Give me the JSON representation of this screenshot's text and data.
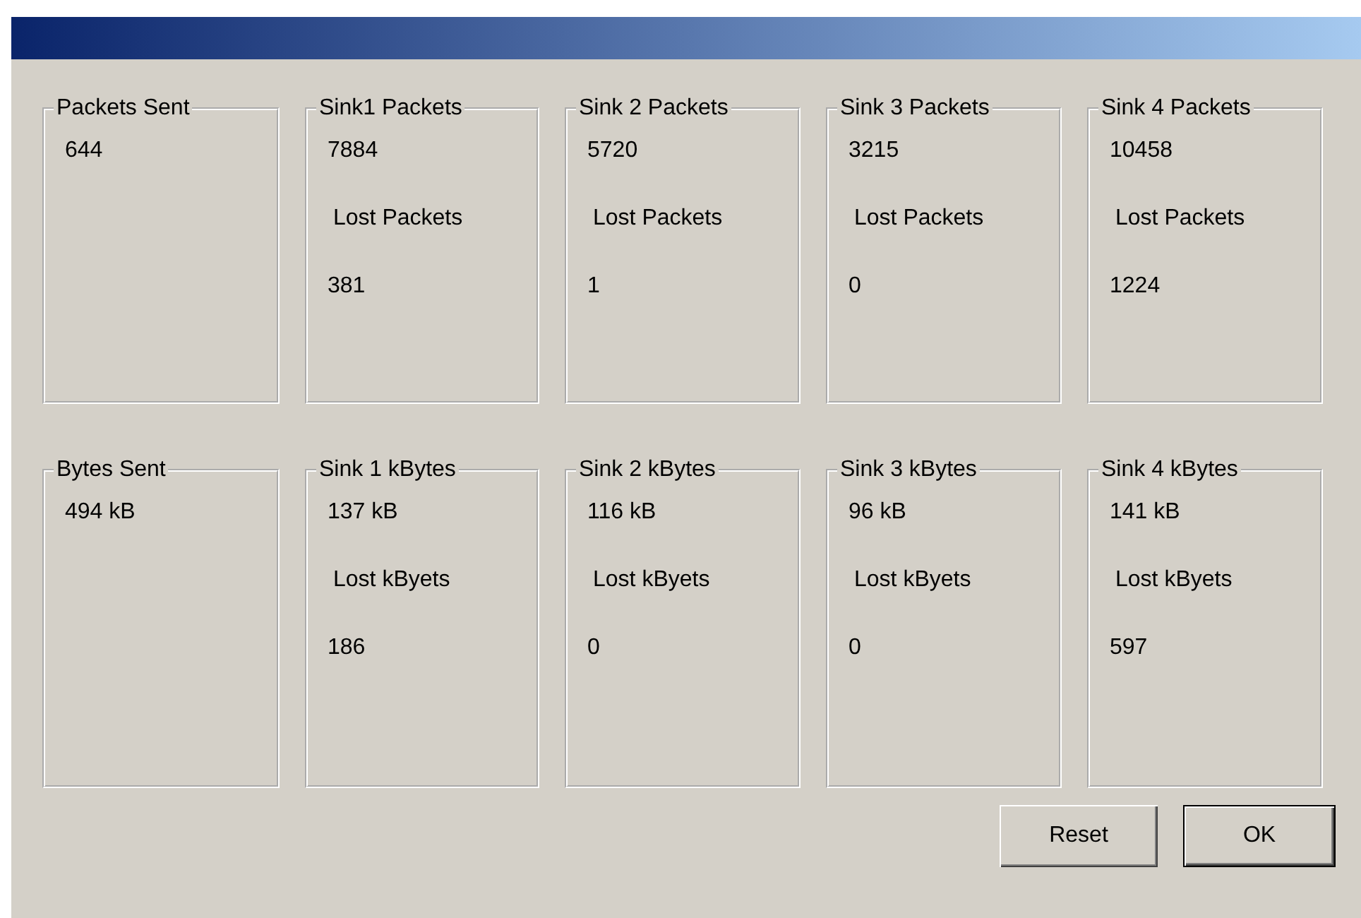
{
  "groups": [
    {
      "title": "Packets Sent",
      "lines": [
        {
          "kind": "value",
          "text": "644"
        }
      ]
    },
    {
      "title": "Sink1 Packets",
      "lines": [
        {
          "kind": "value",
          "text": "7884"
        },
        {
          "kind": "label",
          "text": "Lost Packets"
        },
        {
          "kind": "value",
          "text": "381"
        }
      ]
    },
    {
      "title": "Sink 2 Packets",
      "lines": [
        {
          "kind": "value",
          "text": "5720"
        },
        {
          "kind": "label",
          "text": "Lost Packets"
        },
        {
          "kind": "value",
          "text": "1"
        }
      ]
    },
    {
      "title": "Sink 3 Packets",
      "lines": [
        {
          "kind": "value",
          "text": "3215"
        },
        {
          "kind": "label",
          "text": "Lost Packets"
        },
        {
          "kind": "value",
          "text": "0"
        }
      ]
    },
    {
      "title": "Sink 4 Packets",
      "lines": [
        {
          "kind": "value",
          "text": "10458"
        },
        {
          "kind": "label",
          "text": "Lost Packets"
        },
        {
          "kind": "value",
          "text": "1224"
        }
      ]
    },
    {
      "title": "Bytes Sent",
      "lines": [
        {
          "kind": "value",
          "text": "494 kB"
        }
      ]
    },
    {
      "title": "Sink 1 kBytes",
      "lines": [
        {
          "kind": "value",
          "text": "137 kB"
        },
        {
          "kind": "label",
          "text": "Lost kByets"
        },
        {
          "kind": "value",
          "text": "186"
        }
      ]
    },
    {
      "title": "Sink 2 kBytes",
      "lines": [
        {
          "kind": "value",
          "text": "116 kB"
        },
        {
          "kind": "label",
          "text": "Lost kByets"
        },
        {
          "kind": "value",
          "text": "0"
        }
      ]
    },
    {
      "title": "Sink 3 kBytes",
      "lines": [
        {
          "kind": "value",
          "text": "96 kB"
        },
        {
          "kind": "label",
          "text": "Lost kByets"
        },
        {
          "kind": "value",
          "text": "0"
        }
      ]
    },
    {
      "title": "Sink 4 kBytes",
      "lines": [
        {
          "kind": "value",
          "text": "141 kB"
        },
        {
          "kind": "label",
          "text": "Lost kByets"
        },
        {
          "kind": "value",
          "text": "597"
        }
      ]
    }
  ],
  "buttons": [
    {
      "label": "Reset",
      "default": false
    },
    {
      "label": "OK",
      "default": true
    }
  ]
}
